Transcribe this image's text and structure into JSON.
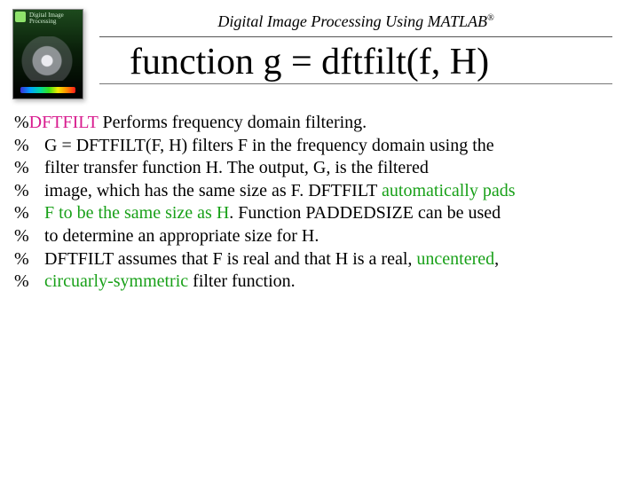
{
  "header": {
    "subtitle_pre": "Digital Image Processing Using MATLAB",
    "registered": "®",
    "title": "function g = dftfilt(f, H)"
  },
  "cover": {
    "line1": "Digital Image",
    "line2": "Processing"
  },
  "lines": {
    "l0": {
      "pct": "%",
      "kw": "DFTFILT",
      "rest": " Performs frequency domain filtering."
    },
    "l1": {
      "pct": "%",
      "text": "G = DFTFILT(F, H) filters F in the frequency domain using the"
    },
    "l2": {
      "pct": "%",
      "text": "filter transfer function H. The output, G, is the filtered"
    },
    "l3": {
      "pct": "%",
      "pre": "image, which has the same size as F. DFTFILT ",
      "hl": "automatically pads"
    },
    "l4": {
      "pct": "%",
      "hl": "F to be the same size as H",
      "post": ". Function PADDEDSIZE can be used"
    },
    "l5": {
      "pct": "%",
      "text": "to determine an appropriate size for H."
    },
    "l6": {
      "pct": "%",
      "pre": "DFTFILT assumes that F is real and that H is a real, ",
      "hl": "uncentered",
      "post": ","
    },
    "l7": {
      "pct": "%",
      "hl": "circuarly-symmetric",
      "post": " filter function."
    }
  }
}
